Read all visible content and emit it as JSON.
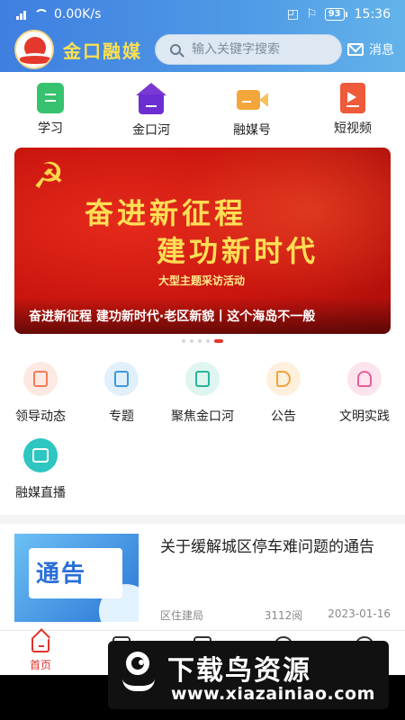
{
  "status_bar": {
    "network_speed": "0.00K/s",
    "battery": "93",
    "time": "15:36"
  },
  "header": {
    "brand": "金口融媒",
    "search_placeholder": "输入关键字搜索",
    "message_label": "消息"
  },
  "top_categories": [
    {
      "label": "学习",
      "icon": "study-icon"
    },
    {
      "label": "金口河",
      "icon": "house-icon"
    },
    {
      "label": "融媒号",
      "icon": "camera-icon"
    },
    {
      "label": "短视频",
      "icon": "video-icon"
    }
  ],
  "banner": {
    "line1": "奋进新征程",
    "line2": "建功新时代",
    "line3": "大型主题采访活动",
    "caption": "奋进新征程 建功新时代·老区新貌丨这个海岛不一般",
    "dot_count": 5,
    "active_dot": 4
  },
  "services": [
    {
      "label": "领导动态",
      "icon": "leader-news-icon",
      "color": "#f27b5a",
      "bg": "#fde9e2"
    },
    {
      "label": "专题",
      "icon": "topic-icon",
      "color": "#3a9bdc",
      "bg": "#e1f0fb"
    },
    {
      "label": "聚焦金口河",
      "icon": "focus-document-icon",
      "color": "#27b59c",
      "bg": "#def5f0"
    },
    {
      "label": "公告",
      "icon": "megaphone-icon",
      "color": "#f0a23a",
      "bg": "#fdf0dc"
    },
    {
      "label": "文明实践",
      "icon": "civilization-icon",
      "color": "#e85c9a",
      "bg": "#fce4ef"
    },
    {
      "label": "融媒直播",
      "icon": "live-stream-icon",
      "color": "#ffffff",
      "bg": "#2ec6c0"
    }
  ],
  "news": [
    {
      "thumbnail_text": "通告",
      "title": "关于缓解城区停车难问题的通告",
      "source": "区住建局",
      "views": "3112阅",
      "date": "2023-01-16"
    }
  ],
  "tabbar": {
    "home_label": "首页"
  },
  "watermark": {
    "title": "下载鸟资源",
    "url": "www.xiazainiao.com"
  },
  "colors": {
    "header_gradient_start": "#3f7fe0",
    "header_gradient_end": "#63b3ea",
    "brand": "#ffe14d",
    "accent_red": "#e0322a"
  }
}
